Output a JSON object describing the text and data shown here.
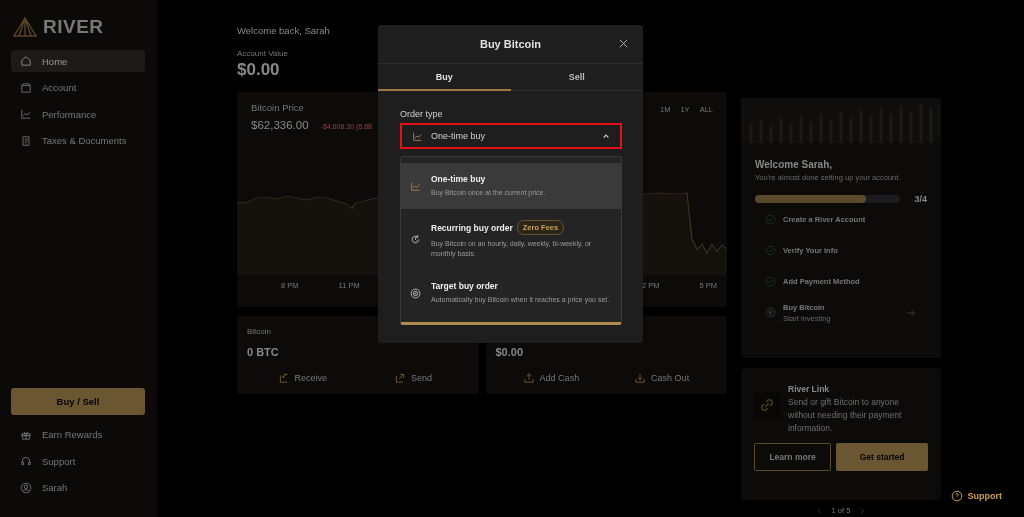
{
  "sidebar": {
    "logo": "RIVER",
    "nav": [
      {
        "label": "Home",
        "selected": true
      },
      {
        "label": "Account",
        "selected": false
      },
      {
        "label": "Performance",
        "selected": false
      },
      {
        "label": "Taxes & Documents",
        "selected": false
      }
    ],
    "primary_button": "Buy / Sell",
    "bottom": [
      "Earn Rewards",
      "Support",
      "Sarah"
    ]
  },
  "greeting": "Welcome back, Sarah",
  "account": {
    "label": "Account Value",
    "value": "$0.00"
  },
  "price_card": {
    "title": "Bitcoin Price",
    "price": "$62,336.00",
    "change": "-$4,608.30 (6.88",
    "ranges": [
      "1M",
      "1Y",
      "ALL"
    ],
    "ticks_left": [
      "8 PM",
      "11 PM"
    ],
    "ticks_right": [
      "2 PM",
      "5 PM"
    ]
  },
  "balances": [
    {
      "label": "Bitcoin",
      "value": "0 BTC",
      "actions": [
        "Receive",
        "Send"
      ]
    },
    {
      "value": "$0.00",
      "actions": [
        "Add Cash",
        "Cash Out"
      ]
    }
  ],
  "onboarding": {
    "title": "Welcome Sarah,",
    "subtitle": "You're almost done setting up your account.",
    "level": 0.76,
    "count": "3/4",
    "steps": [
      {
        "label": "Create a River Account",
        "done": true
      },
      {
        "label": "Verify Your info",
        "done": true
      },
      {
        "label": "Add Payment Method",
        "done": true
      },
      {
        "label": "Buy Bitcoin",
        "sublabel": "Start investing",
        "done": false
      }
    ]
  },
  "promo": {
    "title": "River Link",
    "text": "Send or gift Bitcoin to anyone without needing their payment information.",
    "buttons": [
      "Learn more",
      "Get started"
    ],
    "pager": "1 of 5"
  },
  "support_button": "Support",
  "modal": {
    "title": "Buy Bitcoin",
    "tabs": [
      {
        "label": "Buy",
        "selected": true
      },
      {
        "label": "Sell",
        "selected": false
      }
    ],
    "field_label": "Order type",
    "field_value": "One-time buy",
    "highlighted": true,
    "expanded": true,
    "options": [
      {
        "title": "One-time buy",
        "description": "Buy Bitcoin once at the current price.",
        "selected": true
      },
      {
        "title": "Recurring buy order",
        "badge": "Zero Fees",
        "description": "Buy Bitcoin on an hourly, daily, weekly, bi-weekly, or monthly basis.",
        "selected": false
      },
      {
        "title": "Target buy order",
        "description": "Automatically buy Bitcoin when it reaches a price you set.",
        "selected": false
      }
    ]
  }
}
